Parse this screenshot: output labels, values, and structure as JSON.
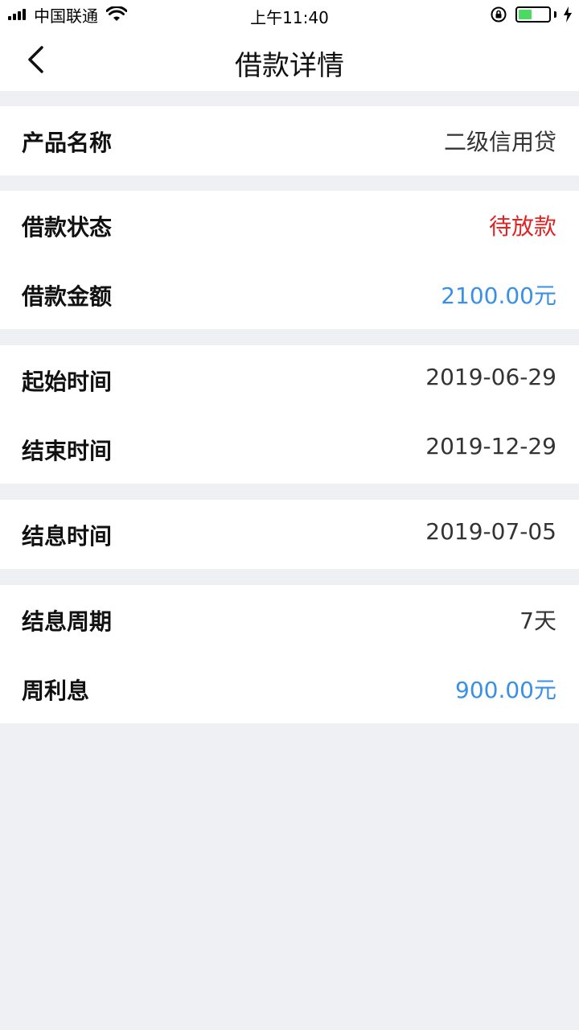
{
  "status_bar": {
    "carrier": "中国联通",
    "time": "上午11:40",
    "battery_percent": 45,
    "battery_color": "#4cd964"
  },
  "nav": {
    "back_icon": "chevron-left-icon",
    "title": "借款详情"
  },
  "colors": {
    "background": "#eff0f4",
    "status_red": "#e02323",
    "amount_blue": "#3a8fe6"
  },
  "sections": [
    {
      "rows": [
        {
          "label": "产品名称",
          "value": "二级信用贷"
        }
      ]
    },
    {
      "rows": [
        {
          "label": "借款状态",
          "value": "待放款"
        },
        {
          "label": "借款金额",
          "value": "2100.00元"
        }
      ]
    },
    {
      "rows": [
        {
          "label": "起始时间",
          "value": "2019-06-29"
        },
        {
          "label": "结束时间",
          "value": "2019-12-29"
        }
      ]
    },
    {
      "rows": [
        {
          "label": "结息时间",
          "value": "2019-07-05"
        }
      ]
    },
    {
      "rows": [
        {
          "label": "结息周期",
          "value": "7天"
        },
        {
          "label": "周利息",
          "value": "900.00元"
        }
      ]
    }
  ]
}
